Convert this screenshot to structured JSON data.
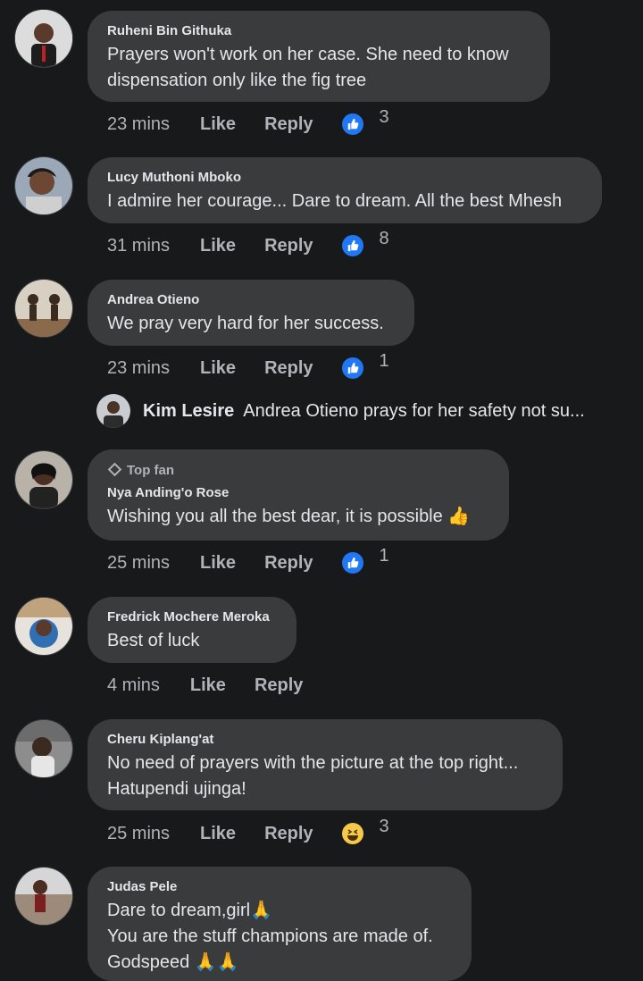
{
  "comments": [
    {
      "author": "Ruheni Bin Githuka",
      "text_lines": [
        "Prayers won't work on her case. She  need to know",
        "dispensation only like the fig tree"
      ],
      "time": "23 mins",
      "like": "Like",
      "reply": "Reply",
      "reaction": "like",
      "count": "3"
    },
    {
      "author": "Lucy Muthoni Mboko",
      "text_lines": [
        "I admire her courage... Dare to dream. All the best Mhesh"
      ],
      "time": "31 mins",
      "like": "Like",
      "reply": "Reply",
      "reaction": "like",
      "count": "8"
    },
    {
      "author": "Andrea Otieno",
      "text_lines": [
        "We pray very hard for her success."
      ],
      "time": "23 mins",
      "like": "Like",
      "reply": "Reply",
      "reaction": "like",
      "count": "1"
    },
    {
      "badge": "Top fan",
      "author": "Nya Anding'o Rose",
      "text_lines": [
        "Wishing you all the best dear, it is possible"
      ],
      "time": "25 mins",
      "like": "Like",
      "reply": "Reply",
      "reaction": "like",
      "count": "1"
    },
    {
      "author": "Fredrick Mochere Meroka",
      "text_lines": [
        "Best of luck"
      ],
      "time": "4 mins",
      "like": "Like",
      "reply": "Reply"
    },
    {
      "author": "Cheru Kiplang'at",
      "text_lines": [
        "No need of prayers with the picture at the top right...",
        "Hatupendi ujinga!"
      ],
      "time": "25 mins",
      "like": "Like",
      "reply": "Reply",
      "reaction": "haha",
      "count": "3"
    },
    {
      "author": "Judas Pele",
      "text_lines": [
        "Dare to dream,girl",
        "You are the stuff champions are made of.",
        "Godspeed"
      ]
    }
  ],
  "reply_preview": {
    "author": "Kim Lesire",
    "text": "Andrea Otieno prays for her safety not su..."
  },
  "colors": {
    "background": "#18191a",
    "bubble": "#3a3b3c",
    "like_blue": "#2078f4",
    "haha_yellow": "#f7c948",
    "muted": "#b0b3b8"
  },
  "icons": {
    "like_reaction": "thumbs-up-icon",
    "haha_reaction": "laughing-face-icon",
    "top_fan": "diamond-icon",
    "thumbs_emoji": "thumbs-up-emoji",
    "pray_emoji": "folded-hands-emoji"
  }
}
